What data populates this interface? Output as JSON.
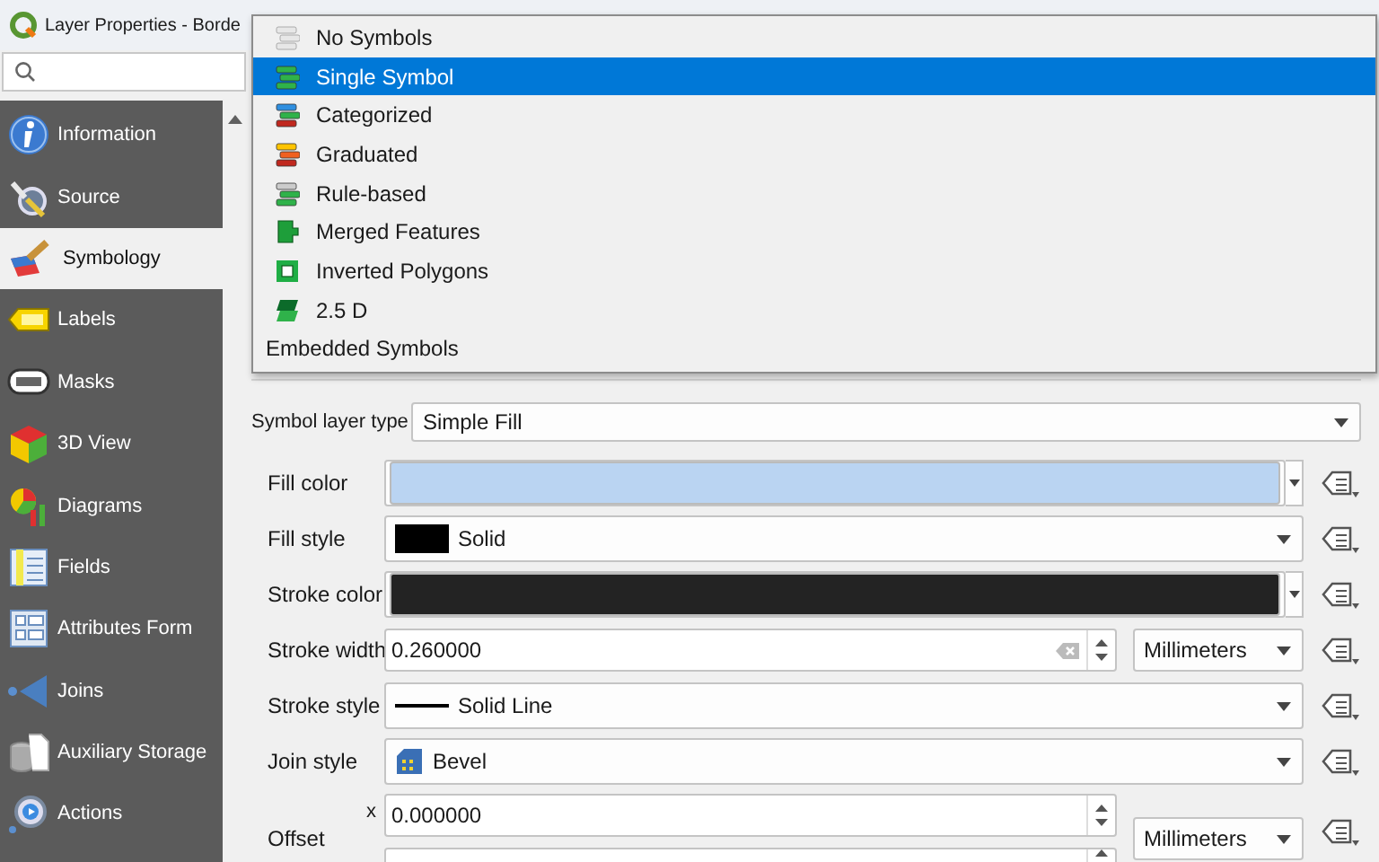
{
  "window": {
    "title": "Layer Properties - Borde"
  },
  "sidebar": {
    "items": [
      {
        "label": "Information",
        "selected": false
      },
      {
        "label": "Source",
        "selected": false
      },
      {
        "label": "Symbology",
        "selected": true
      },
      {
        "label": "Labels",
        "selected": false
      },
      {
        "label": "Masks",
        "selected": false
      },
      {
        "label": "3D View",
        "selected": false
      },
      {
        "label": "Diagrams",
        "selected": false
      },
      {
        "label": "Fields",
        "selected": false
      },
      {
        "label": "Attributes Form",
        "selected": false
      },
      {
        "label": "Joins",
        "selected": false
      },
      {
        "label": "Auxiliary Storage",
        "selected": false
      },
      {
        "label": "Actions",
        "selected": false
      }
    ]
  },
  "renderer_menu": {
    "items": [
      {
        "label": "No Symbols",
        "selected": false
      },
      {
        "label": "Single Symbol",
        "selected": true
      },
      {
        "label": "Categorized",
        "selected": false
      },
      {
        "label": "Graduated",
        "selected": false
      },
      {
        "label": "Rule-based",
        "selected": false
      },
      {
        "label": "Merged Features",
        "selected": false
      },
      {
        "label": "Inverted Polygons",
        "selected": false
      },
      {
        "label": "2.5 D",
        "selected": false
      }
    ],
    "section": "Embedded Symbols"
  },
  "symbol_layer_type": {
    "label": "Symbol layer type",
    "value": "Simple Fill"
  },
  "form": {
    "rows": [
      {
        "kind": "color",
        "label": "Fill color",
        "color": "#bad4f2"
      },
      {
        "kind": "fill-style",
        "label": "Fill style",
        "value": "Solid"
      },
      {
        "kind": "color",
        "label": "Stroke color",
        "color": "#232323"
      },
      {
        "kind": "number",
        "label": "Stroke width",
        "value": "0.260000",
        "unit": "Millimeters"
      },
      {
        "kind": "line-style",
        "label": "Stroke style",
        "value": "Solid Line"
      },
      {
        "kind": "join-style",
        "label": "Join style",
        "value": "Bevel"
      },
      {
        "kind": "offset",
        "label": "Offset",
        "axis": "x",
        "value": "0.000000",
        "unit": "Millimeters"
      }
    ]
  }
}
